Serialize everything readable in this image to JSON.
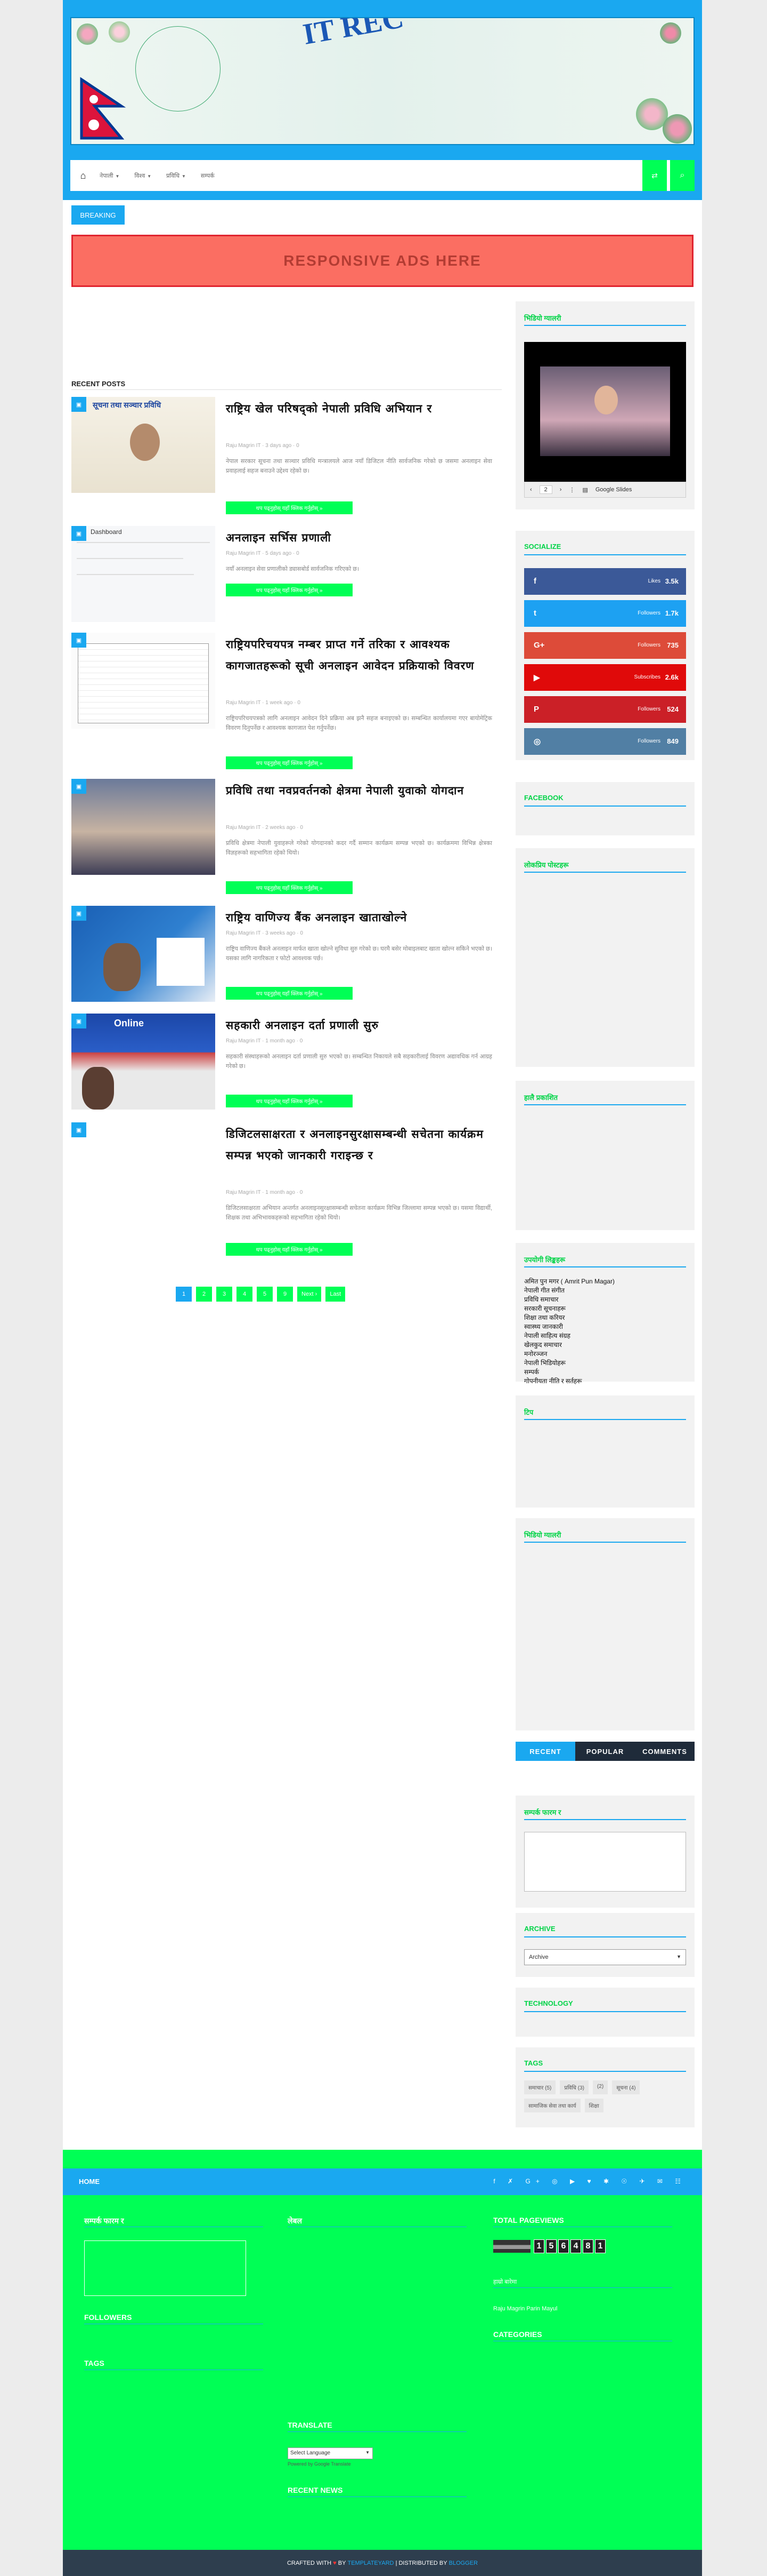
{
  "header": {
    "logo_text": "IT REC",
    "nav": {
      "home_icon": "home-icon",
      "menu": [
        {
          "label": "नेपाली",
          "has_caret": true
        },
        {
          "label": "विश्व",
          "has_caret": true
        },
        {
          "label": "प्रविधि",
          "has_caret": true
        },
        {
          "label": "सम्पर्क",
          "has_caret": false
        }
      ]
    }
  },
  "breaking_label": "BREAKING",
  "ad_label": "RESPONSIVE ADS HERE",
  "main": {
    "recent_title": "RECENT POSTS",
    "read_more": "थप पढ्नुहोस् यहाँ क्लिक गर्नुहोस् »",
    "posts": [
      {
        "title": "राष्ट्रिय खेल परिषद्को नेपाली प्रविधि अभियान र",
        "meta": "Raju Magrin IT  ·  3 days ago  ·  0",
        "excerpt": "नेपाल सरकार सूचना तथा सञ्चार प्रविधि मन्त्रालयले आज नयाँ डिजिटल नीति सार्वजनिक गरेको छ जसमा अनलाइन सेवा प्रवाहलाई सहज बनाउने उद्देश्य रहेको छ।",
        "thumb_caption": "सूचना तथा सञ्चार प्रविधि"
      },
      {
        "title": "अनलाइन सर्भिस प्रणाली",
        "meta": "Raju Magrin IT  ·  5 days ago  ·  0",
        "excerpt": "नयाँ अनलाइन सेवा प्रणालीको ड्यासबोर्ड सार्वजनिक गरिएको छ।",
        "thumb_caption": "Dashboard"
      },
      {
        "title": "राष्ट्रियपरिचयपत्र नम्बर प्राप्त गर्ने तरिका र आवश्यक कागजातहरूको सूची अनलाइन आवेदन प्रक्रियाको विवरण",
        "meta": "Raju Magrin IT  ·  1 week ago  ·  0",
        "excerpt": "राष्ट्रियपरिचयपत्रको लागि अनलाइन आवेदन दिने प्रक्रिया अब झनै सहज बनाइएको छ। सम्बन्धित कार्यालयमा गएर बायोमेट्रिक विवरण दिनुपर्नेछ र आवश्यक कागजात पेश गर्नुपर्नेछ।",
        "thumb_caption": "Form"
      },
      {
        "title": "प्रविधि तथा नवप्रवर्तनको क्षेत्रमा नेपाली युवाको योगदान",
        "meta": "Raju Magrin IT  ·  2 weeks ago  ·  0",
        "excerpt": "प्रविधि क्षेत्रमा नेपाली युवाहरूले गरेको योगदानको कदर गर्दै सम्मान कार्यक्रम सम्पन्न भएको छ। कार्यक्रममा विभिन्न क्षेत्रका विज्ञहरूको सहभागिता रहेको थियो।",
        "thumb_caption": "Ceremony"
      },
      {
        "title": "राष्ट्रिय वाणिज्य बैंक अनलाइन खाताखोल्ने",
        "meta": "Raju Magrin IT  ·  3 weeks ago  ·  0",
        "excerpt": "राष्ट्रिय वाणिज्य बैंकले अनलाइन मार्फत खाता खोल्ने सुविधा सुरु गरेको छ। घरमै बसेर मोबाइलबाट खाता खोल्न सकिने भएको छ। यसका लागि नागरिकता र फोटो आवश्यक पर्छ।",
        "thumb_caption": "Bank"
      },
      {
        "title": "सहकारी अनलाइन दर्ता प्रणाली सुरु",
        "meta": "Raju Magrin IT  ·  1 month ago  ·  0",
        "excerpt": "सहकारी संस्थाहरूको अनलाइन दर्ता प्रणाली सुरु भएको छ। सम्बन्धित निकायले सबै सहकारीलाई विवरण अद्यावधिक गर्न आग्रह गरेको छ।",
        "thumb_caption": "Online"
      },
      {
        "title": "डिजिटलसाक्षरता र अनलाइनसुरक्षासम्बन्धी सचेतना कार्यक्रम सम्पन्न भएको जानकारी गराइन्छ र",
        "meta": "Raju Magrin IT  ·  1 month ago  ·  0",
        "excerpt": "डिजिटलसाक्षरता अभियान अन्तर्गत अनलाइनसुरक्षासम्बन्धी सचेतना कार्यक्रम विभिन्न जिल्लामा सम्पन्न भएको छ। यसमा विद्यार्थी, शिक्षक तथा अभिभावकहरूको सहभागिता रहेको थियो।",
        "thumb_caption": ""
      }
    ],
    "pager": [
      "1",
      "2",
      "3",
      "4",
      "5",
      "9",
      "Next ›",
      "Last"
    ]
  },
  "sidebar": {
    "video_title": "भिडियो ग्यालरी",
    "slides_page": "2",
    "slides_label": "Google Slides",
    "socialize_title": "SOCIALIZE",
    "social": [
      {
        "icon": "facebook-icon",
        "glyph": "f",
        "label": "Likes",
        "count": "3.5k",
        "color": "#3b5998"
      },
      {
        "icon": "twitter-icon",
        "glyph": "t",
        "label": "Followers",
        "count": "1.7k",
        "color": "#1da1f2"
      },
      {
        "icon": "google-plus-icon",
        "glyph": "G+",
        "label": "Followers",
        "count": "735",
        "color": "#dd4b39"
      },
      {
        "icon": "youtube-icon",
        "glyph": "▶",
        "label": "Subscribes",
        "count": "2.6k",
        "color": "#e00a0a"
      },
      {
        "icon": "pinterest-icon",
        "glyph": "P",
        "label": "Followers",
        "count": "524",
        "color": "#cb2027"
      },
      {
        "icon": "instagram-icon",
        "glyph": "◎",
        "label": "Followers",
        "count": "849",
        "color": "#517fa4"
      }
    ],
    "facebook_title": "FACEBOOK",
    "popular_title": "लोकप्रिय पोस्टहरू",
    "widget2_title": "हालै प्रकाशित",
    "links_title": "उपयोगी लिङ्कहरू",
    "links": [
      "अमित पुन मगर ( Amrit Pun Magar)",
      "नेपाली गीत संगीत",
      "प्रविधि समाचार",
      "सरकारी सूचनाहरू",
      "शिक्षा तथा करियर",
      "स्वास्थ्य जानकारी",
      "नेपाली साहित्य संग्रह",
      "खेलकुद समाचार",
      "मनोरञ्जन",
      "नेपाली भिडियोहरू",
      "सम्पर्क",
      "गोपनीयता नीति र सर्तहरू"
    ],
    "empty1_title": "टिप",
    "empty2_title": "भिडियो ग्यालरी",
    "tabs": [
      "RECENT",
      "POPULAR",
      "COMMENTS"
    ],
    "contact_title": "सम्पर्क फारम र",
    "archive_title": "ARCHIVE",
    "archive_select": "Archive",
    "technology_title": "TECHNOLOGY",
    "tags_title": "TAGS",
    "tags": [
      "समाचार (5)",
      "प्रविधि (3)",
      "(2)",
      "सूचना (4)",
      "सामाजिक सेवा तथा कार्य",
      "शिक्षा"
    ]
  },
  "footer": {
    "home": "HOME",
    "col1_title": "सम्पर्क फारम र",
    "col2_title": "लेबल",
    "col3_title": "TOTAL PAGEVIEWS",
    "pageviews": "156481",
    "followers_title": "FOLLOWERS",
    "tags_title": "TAGS",
    "about_title": "हाम्रो बारेमा",
    "about_text": "Raju Magrin Parin Mayul",
    "categories_title": "CATEGORIES",
    "translate_title": "TRANSLATE",
    "translate_select": "Select Language",
    "powered": "Powered by Google Translate",
    "recent_news_title": "RECENT NEWS",
    "credit_pre": "CRAFTED WITH",
    "credit_by": "BY",
    "credit_brand": "TEMPLATEYARD",
    "credit_mid": "| DISTRIBUTED BY",
    "credit_dist": "BLOGGER"
  }
}
